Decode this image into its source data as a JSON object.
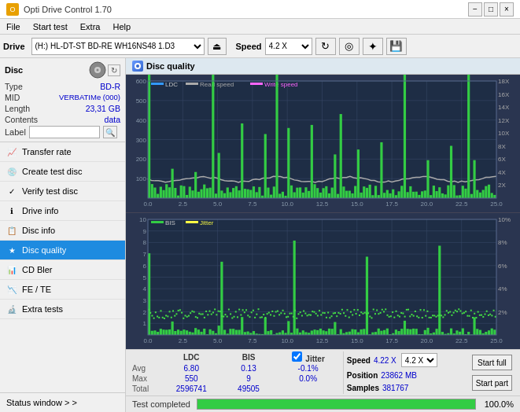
{
  "app": {
    "title": "Opti Drive Control 1.70",
    "icon": "ODC"
  },
  "title_controls": {
    "minimize": "−",
    "maximize": "□",
    "close": "×"
  },
  "menu": {
    "items": [
      "File",
      "Start test",
      "Extra",
      "Help"
    ]
  },
  "toolbar": {
    "drive_label": "Drive",
    "drive_value": "(H:) HL-DT-ST BD-RE  WH16NS48 1.D3",
    "eject_icon": "⏏",
    "speed_label": "Speed",
    "speed_value": "4.2 X",
    "icons": [
      "↻",
      "◎",
      "✦",
      "💾"
    ]
  },
  "disc_panel": {
    "title": "Disc",
    "type_label": "Type",
    "type_value": "BD-R",
    "mid_label": "MID",
    "mid_value": "VERBATIMe (000)",
    "length_label": "Length",
    "length_value": "23,31 GB",
    "contents_label": "Contents",
    "contents_value": "data",
    "label_label": "Label",
    "label_placeholder": ""
  },
  "nav": {
    "items": [
      {
        "id": "transfer-rate",
        "label": "Transfer rate",
        "icon": "📈"
      },
      {
        "id": "create-test-disc",
        "label": "Create test disc",
        "icon": "💿"
      },
      {
        "id": "verify-test-disc",
        "label": "Verify test disc",
        "icon": "✓"
      },
      {
        "id": "drive-info",
        "label": "Drive info",
        "icon": "ℹ"
      },
      {
        "id": "disc-info",
        "label": "Disc info",
        "icon": "📋"
      },
      {
        "id": "disc-quality",
        "label": "Disc quality",
        "icon": "★",
        "active": true
      },
      {
        "id": "cd-bler",
        "label": "CD Bler",
        "icon": "📊"
      },
      {
        "id": "fe-te",
        "label": "FE / TE",
        "icon": "📉"
      },
      {
        "id": "extra-tests",
        "label": "Extra tests",
        "icon": "🔬"
      }
    ],
    "status_window": "Status window > >"
  },
  "disc_quality": {
    "title": "Disc quality",
    "legend": {
      "ldc_label": "LDC",
      "ldc_color": "#3399ff",
      "read_speed_label": "Read speed",
      "read_speed_color": "#aaaaaa",
      "write_speed_label": "Write speed",
      "write_speed_color": "#ff44ff",
      "bis_label": "BIS",
      "bis_color": "#33ff33",
      "jitter_label": "Jitter",
      "jitter_color": "#ffff00"
    },
    "top_chart": {
      "y_max": 600,
      "x_max": 25.0,
      "x_label": "GB",
      "right_max": 18,
      "x_ticks": [
        0.0,
        2.5,
        5.0,
        7.5,
        10.0,
        12.5,
        15.0,
        17.5,
        20.0,
        22.5,
        25.0
      ],
      "right_ticks": [
        2,
        4,
        6,
        8,
        10,
        12,
        14,
        16,
        18
      ]
    },
    "bottom_chart": {
      "y_max": 10,
      "x_max": 25.0,
      "right_max": 10,
      "x_ticks": [
        0.0,
        2.5,
        5.0,
        7.5,
        10.0,
        12.5,
        15.0,
        17.5,
        20.0,
        22.5,
        25.0
      ],
      "right_ticks": [
        "2%",
        "4%",
        "6%",
        "8%",
        "10%"
      ]
    }
  },
  "stats": {
    "ldc_header": "LDC",
    "bis_header": "BIS",
    "jitter_checked": true,
    "jitter_header": "Jitter",
    "speed_header": "Speed",
    "speed_value": "4.22 X",
    "speed_select": "4.2 X",
    "avg_label": "Avg",
    "avg_ldc": "6.80",
    "avg_bis": "0.13",
    "avg_jitter": "-0.1%",
    "max_label": "Max",
    "max_ldc": "550",
    "max_bis": "9",
    "max_jitter": "0.0%",
    "total_label": "Total",
    "total_ldc": "2596741",
    "total_bis": "49505",
    "position_label": "Position",
    "position_value": "23862 MB",
    "samples_label": "Samples",
    "samples_value": "381767",
    "start_full": "Start full",
    "start_part": "Start part"
  },
  "progress": {
    "status_text": "Test completed",
    "percent": 100,
    "percent_display": "100.0%"
  }
}
